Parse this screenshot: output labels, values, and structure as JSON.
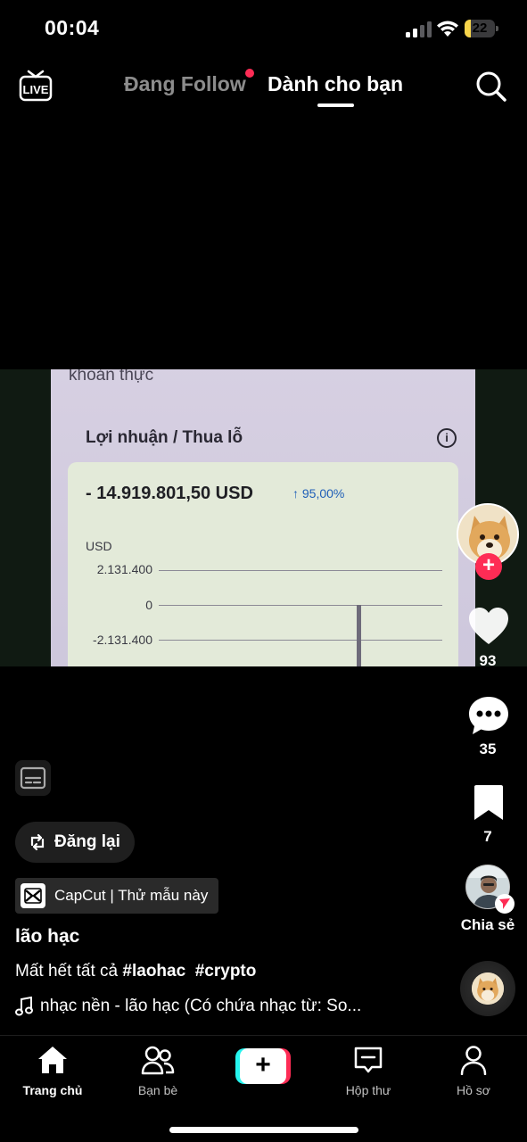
{
  "status_bar": {
    "time": "00:04",
    "battery_level": "22",
    "battery_fraction": 0.22,
    "signal_icon": "cellular-signal-icon",
    "wifi_icon": "wifi-icon"
  },
  "top_nav": {
    "live_label": "LIVE",
    "tabs": [
      {
        "label": "Đang Follow",
        "active": false,
        "has_notification_dot": true
      },
      {
        "label": "Dành cho bạn",
        "active": true
      }
    ],
    "search_icon": "search-icon"
  },
  "video": {
    "top_text": "khoản thực",
    "section_title": "Lợi nhuận / Thua lỗ",
    "amount": "- 14.919.801,50  USD",
    "percent": "↑ 95,00%",
    "axis_unit": "USD",
    "ticks": [
      "2.131.400",
      "0",
      "-2.131.400"
    ]
  },
  "right_rail": {
    "likes": "93",
    "comments": "35",
    "saves": "7",
    "share_label": "Chia sẻ",
    "follow_icon": "plus-icon"
  },
  "caption": {
    "repost_label": "Đăng lại",
    "capcut_label": "CapCut | Thử mẫu này",
    "author": "lão hạc",
    "text": "Mất hết tất cả ",
    "tags": [
      "#laohac",
      "#crypto"
    ],
    "sound": "nhạc nền - lão hạc (Có chứa nhạc từ: So..."
  },
  "bottom_nav": {
    "items": [
      {
        "label": "Trang chủ",
        "icon": "home-icon",
        "active": true
      },
      {
        "label": "Bạn bè",
        "icon": "friends-icon",
        "active": false
      },
      {
        "label": "",
        "icon": "create-plus-icon",
        "active": false
      },
      {
        "label": "Hộp thư",
        "icon": "inbox-icon",
        "active": false
      },
      {
        "label": "Hồ sơ",
        "icon": "profile-icon",
        "active": false
      }
    ]
  },
  "colors": {
    "accent": "#fe2c55",
    "accent_secondary": "#25f4ee",
    "battery": "#f7d44a"
  }
}
